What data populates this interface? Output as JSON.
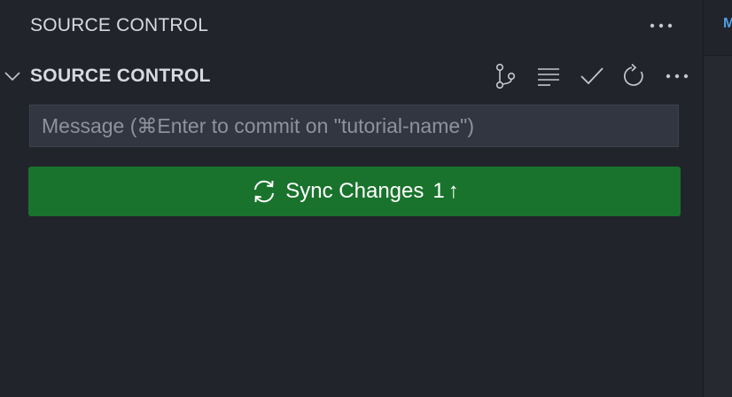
{
  "view": {
    "title": "SOURCE CONTROL",
    "more_icon": "ellipsis-icon"
  },
  "section": {
    "title": "SOURCE CONTROL",
    "expanded": true,
    "actions": [
      {
        "name": "branch-graph-icon",
        "tooltip": "Graph"
      },
      {
        "name": "list-view-icon",
        "tooltip": "View as List"
      },
      {
        "name": "checkmark-icon",
        "tooltip": "Commit"
      },
      {
        "name": "refresh-icon",
        "tooltip": "Refresh"
      },
      {
        "name": "ellipsis-icon",
        "tooltip": "More Actions"
      }
    ]
  },
  "commit": {
    "value": "",
    "placeholder": "Message (⌘Enter to commit on \"tutorial-name\")"
  },
  "sync": {
    "label": "Sync Changes",
    "count": "1",
    "arrow": "↑",
    "icon": "sync-icon"
  },
  "editor": {
    "tab_glyph": "M"
  },
  "colors": {
    "background": "#21252b",
    "button": "#19732c",
    "input_background": "#313641",
    "accent": "#4d9ee8"
  }
}
